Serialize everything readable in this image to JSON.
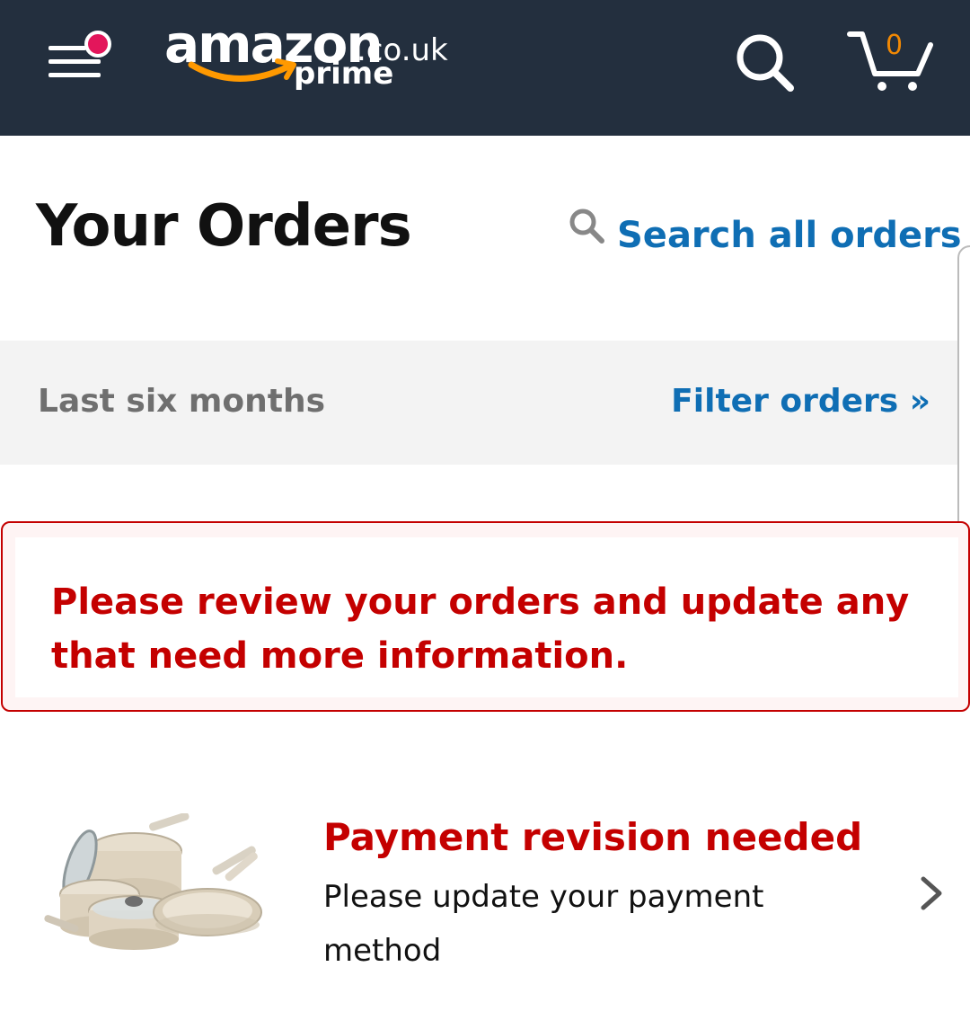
{
  "header": {
    "logo": {
      "brand": "amazon",
      "domain": ".co.uk",
      "sub": "prime"
    },
    "cart_count": "0",
    "icons": {
      "menu": "hamburger-menu-icon",
      "notification": "notification-dot-icon",
      "search": "search-icon",
      "cart": "cart-icon"
    },
    "colors": {
      "background": "#232f3e",
      "notification_dot": "#e3165b",
      "smile": "#f90",
      "cart_count": "#f08804"
    }
  },
  "main": {
    "title": "Your Orders",
    "search_orders_label": "Search all orders"
  },
  "filter": {
    "range_label": "Last six months",
    "filter_link": "Filter orders »"
  },
  "alert": {
    "message": "Please review your orders and update any that need more information.",
    "color": "#c40000"
  },
  "orders": [
    {
      "status": "Payment revision needed",
      "description": "Please update your payment method",
      "thumbnail": "cookware-set-image",
      "status_color": "#c40000"
    }
  ],
  "colors": {
    "link": "#0f6eb4",
    "filter_bar": "#f3f3f3"
  }
}
